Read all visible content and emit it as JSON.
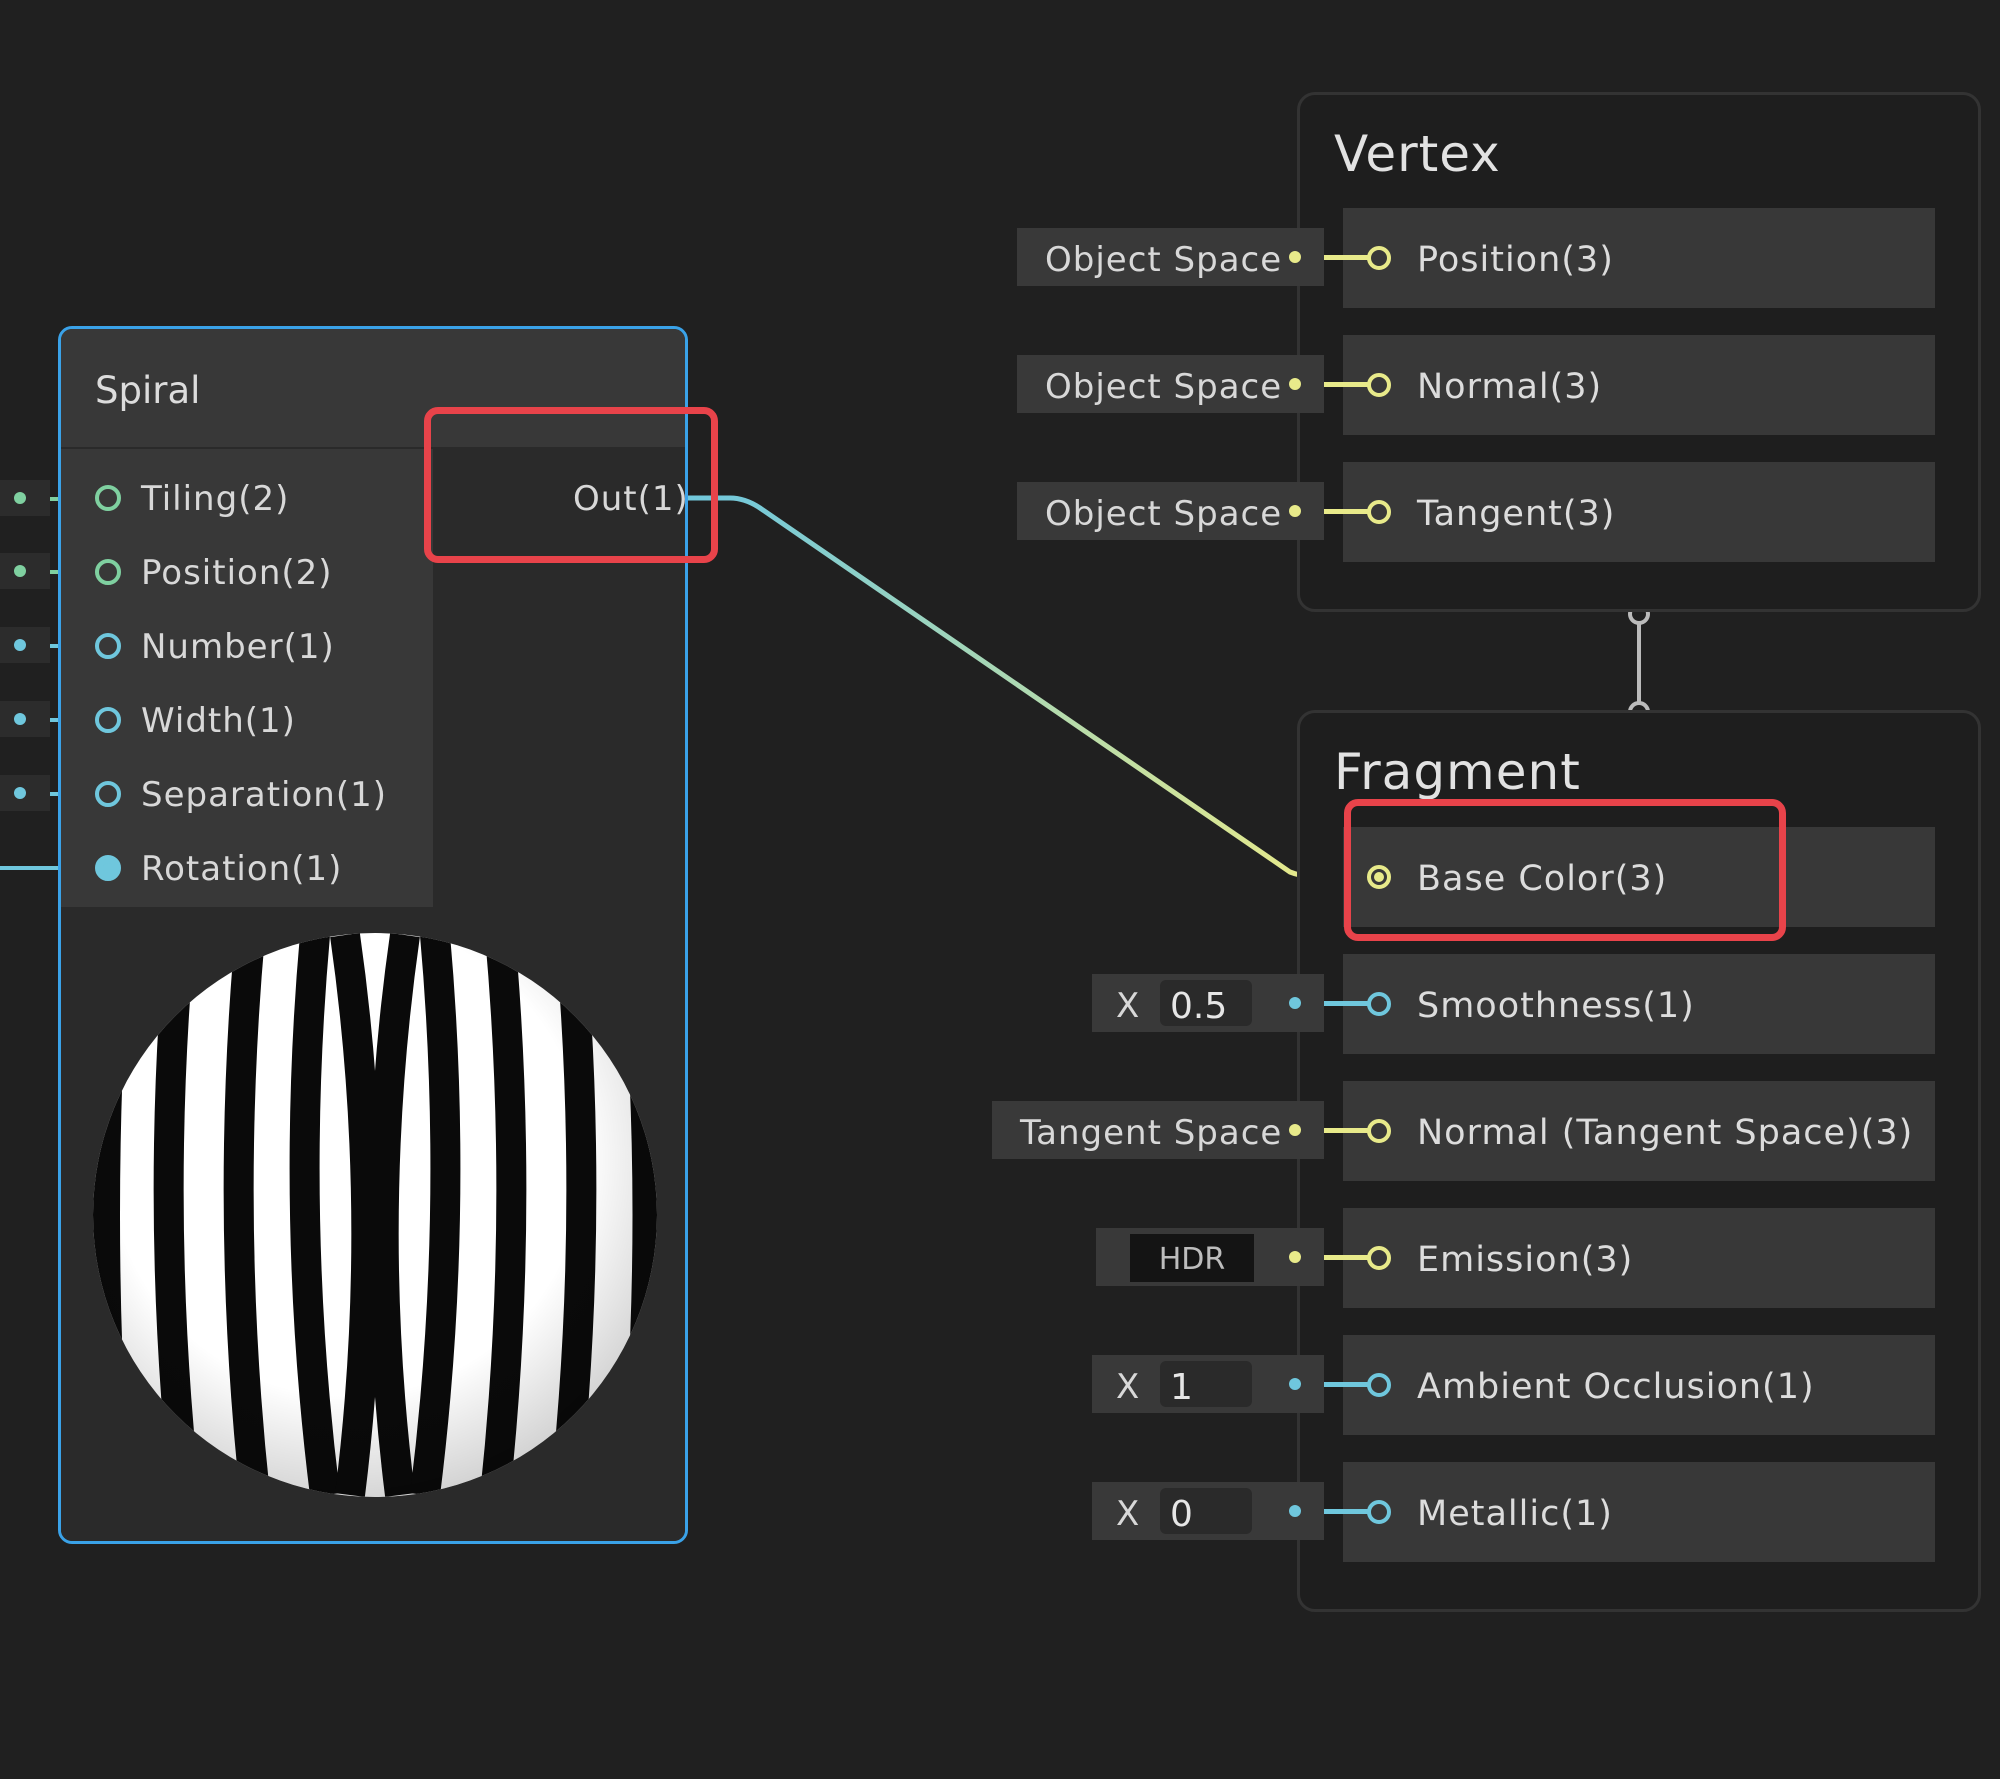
{
  "spiral_node": {
    "title": "Spiral",
    "inputs": [
      {
        "label": "Tiling(2)"
      },
      {
        "label": "Position(2)"
      },
      {
        "label": "Number(1)"
      },
      {
        "label": "Width(1)"
      },
      {
        "label": "Separation(1)"
      },
      {
        "label": "Rotation(1)"
      }
    ],
    "output": {
      "label": "Out(1)"
    }
  },
  "vertex": {
    "title": "Vertex",
    "blocks": [
      {
        "label": "Position(3)",
        "field": "Object Space"
      },
      {
        "label": "Normal(3)",
        "field": "Object Space"
      },
      {
        "label": "Tangent(3)",
        "field": "Object Space"
      }
    ]
  },
  "fragment": {
    "title": "Fragment",
    "blocks": [
      {
        "label": "Base Color(3)"
      },
      {
        "label": "Smoothness(1)",
        "axis": "X",
        "value": "0.5"
      },
      {
        "label": "Normal (Tangent Space)(3)",
        "field": "Tangent Space"
      },
      {
        "label": "Emission(3)",
        "field": "HDR"
      },
      {
        "label": "Ambient Occlusion(1)",
        "axis": "X",
        "value": "1"
      },
      {
        "label": "Metallic(1)",
        "axis": "X",
        "value": "0"
      }
    ]
  },
  "colors": {
    "selection_border": "#3aa2e8",
    "highlight": "#e8434a",
    "port_yellow": "#e8ea8a",
    "port_cyan": "#6fc7dd",
    "port_green": "#7fd0a0"
  }
}
